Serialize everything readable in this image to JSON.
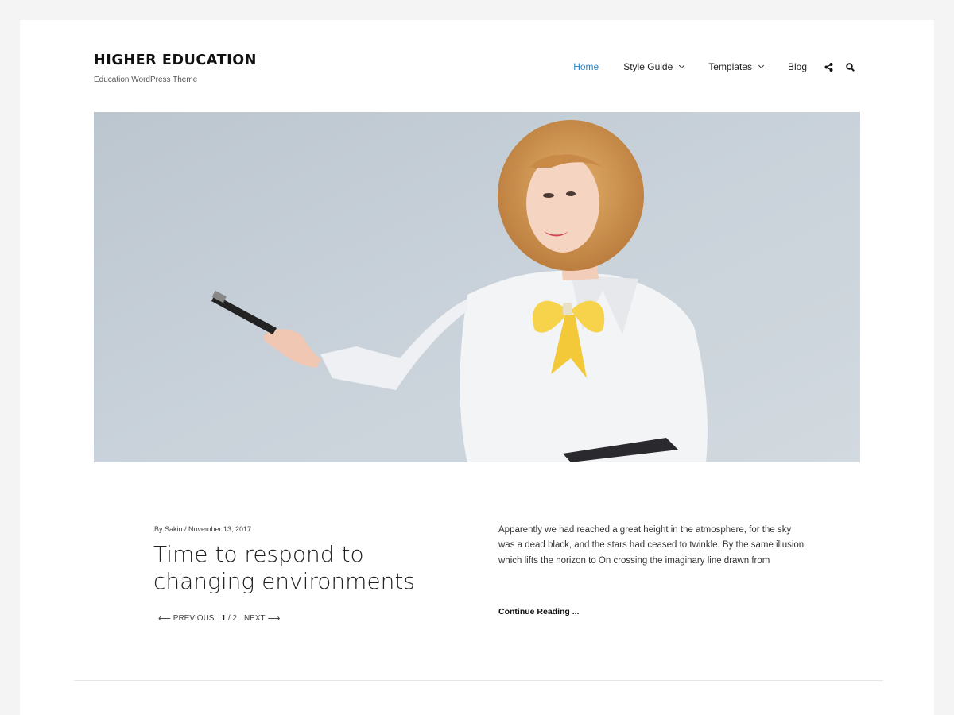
{
  "site": {
    "title": "HIGHER EDUCATION",
    "tagline": "Education WordPress Theme"
  },
  "nav": {
    "items": [
      {
        "label": "Home",
        "active": true
      },
      {
        "label": "Style Guide",
        "dropdown": true
      },
      {
        "label": "Templates",
        "dropdown": true
      },
      {
        "label": "Blog"
      }
    ],
    "icons": [
      "share-icon",
      "search-icon"
    ]
  },
  "hero": {
    "image": "woman-presenting-with-pen-photo"
  },
  "post": {
    "meta": "By Sakin / November 13, 2017",
    "title": "Time to respond to changing environments",
    "excerpt": "Apparently we had reached a great height in the atmosphere, for the sky was a dead black, and the stars had ceased to twinkle. By the same illusion which lifts the horizon to On crossing the imaginary line drawn from",
    "continue_label": "Continue Reading ..."
  },
  "pager": {
    "previous_label": "PREVIOUS",
    "current": "1",
    "separator": "/",
    "total": "2",
    "next_label": "NEXT"
  },
  "colors": {
    "accent": "#1e88d6",
    "page_bg": "#f4f4f4"
  }
}
